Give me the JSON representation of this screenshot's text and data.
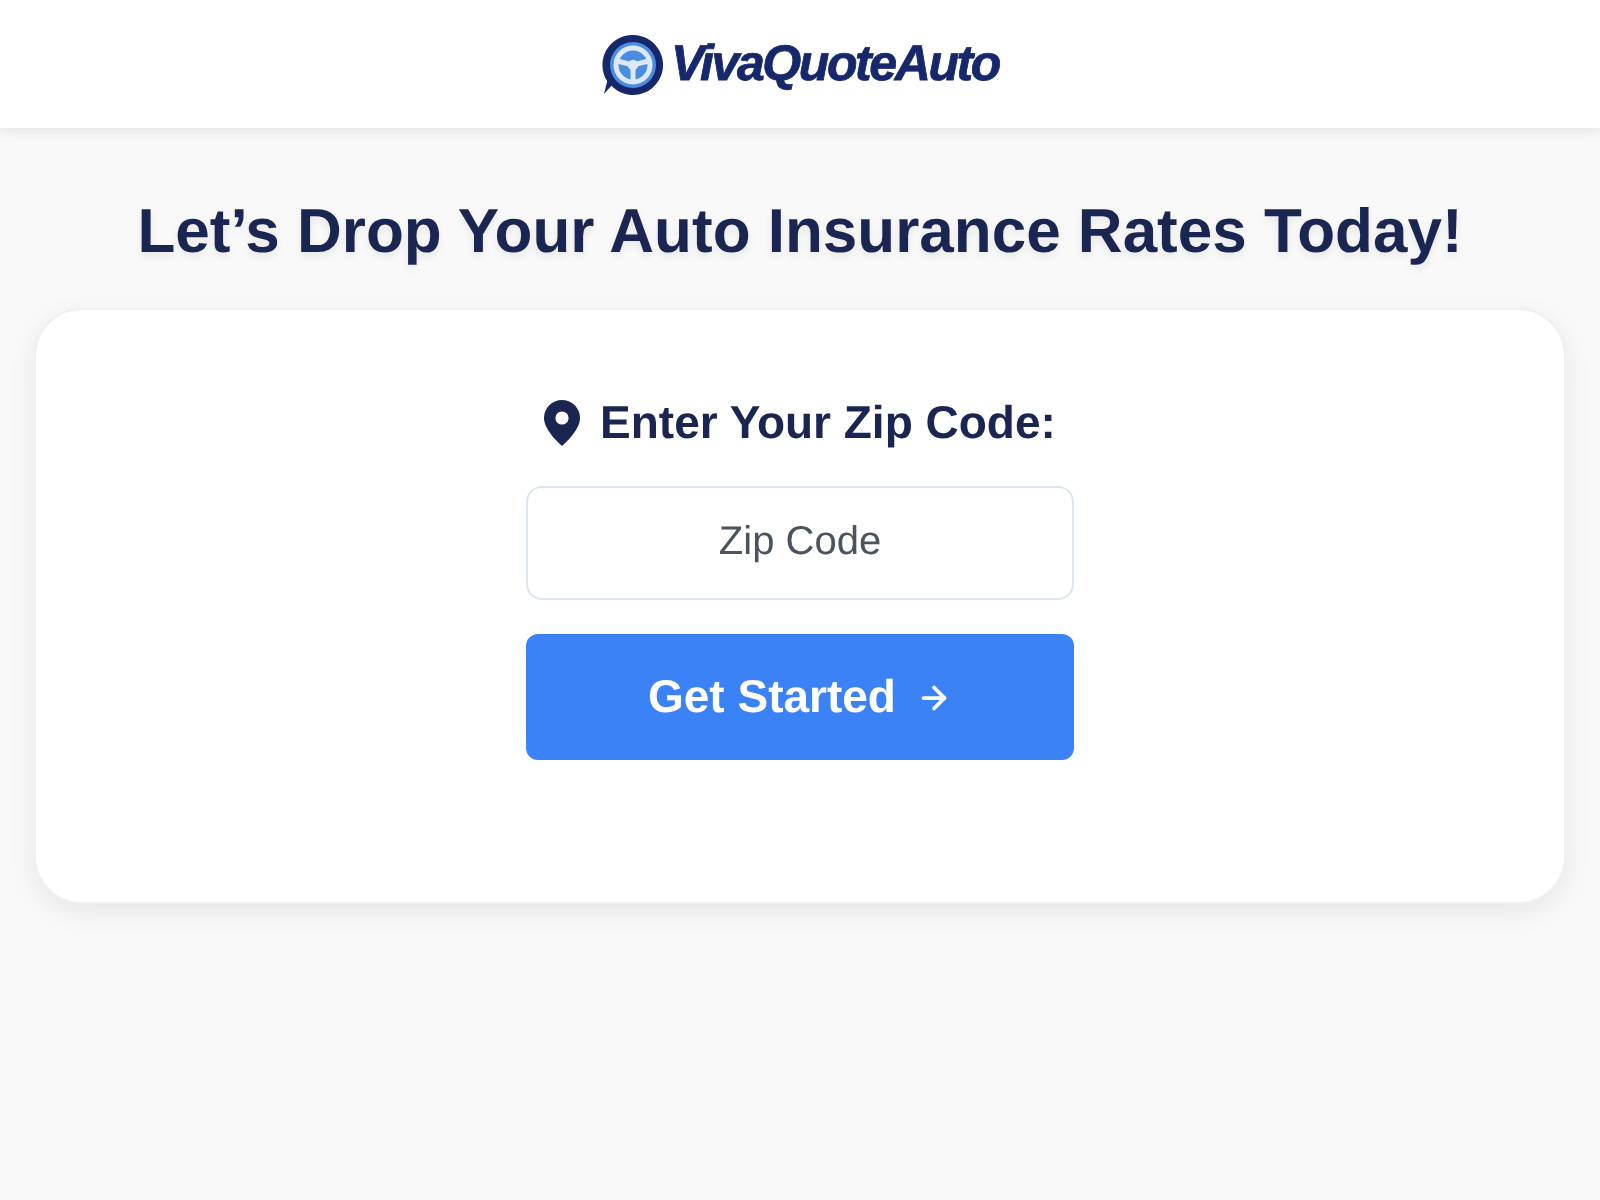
{
  "header": {
    "logo_text": "VivaQuoteAuto"
  },
  "headline": "Let’s Drop Your Auto Insurance Rates Today!",
  "form": {
    "label": "Enter Your Zip Code:",
    "zip_field": {
      "placeholder": "Zip Code"
    },
    "submit_button": {
      "label": "Get Started"
    }
  }
}
